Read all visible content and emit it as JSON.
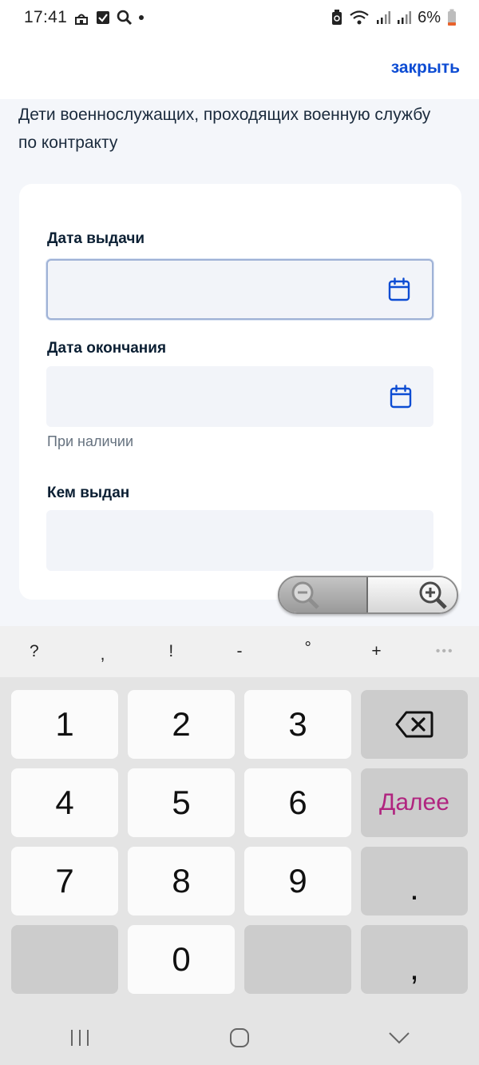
{
  "status_bar": {
    "time": "17:41",
    "battery_percent": "6%"
  },
  "header": {
    "close_label": "закрыть"
  },
  "subtitle": "Дети военнослужащих, проходящих военную службу по контракту",
  "form": {
    "issue_date_label": "Дата выдачи",
    "issue_date_value": "",
    "end_date_label": "Дата окончания",
    "end_date_value": "",
    "end_date_hint": "При наличии",
    "issued_by_label": "Кем выдан",
    "issued_by_value": ""
  },
  "keyboard": {
    "symbols": [
      "?",
      ",",
      "!",
      "-",
      "°",
      "+",
      "•••"
    ],
    "keys": {
      "k1": "1",
      "k2": "2",
      "k3": "3",
      "k4": "4",
      "k5": "5",
      "k6": "6",
      "k7": "7",
      "k8": "8",
      "k9": "9",
      "k0": "0",
      "next": "Далее",
      "dot": ".",
      "comma": ","
    }
  },
  "colors": {
    "accent": "#0d4cd3",
    "keyboard_action": "#b0247f",
    "page_bg": "#f4f6fa"
  }
}
